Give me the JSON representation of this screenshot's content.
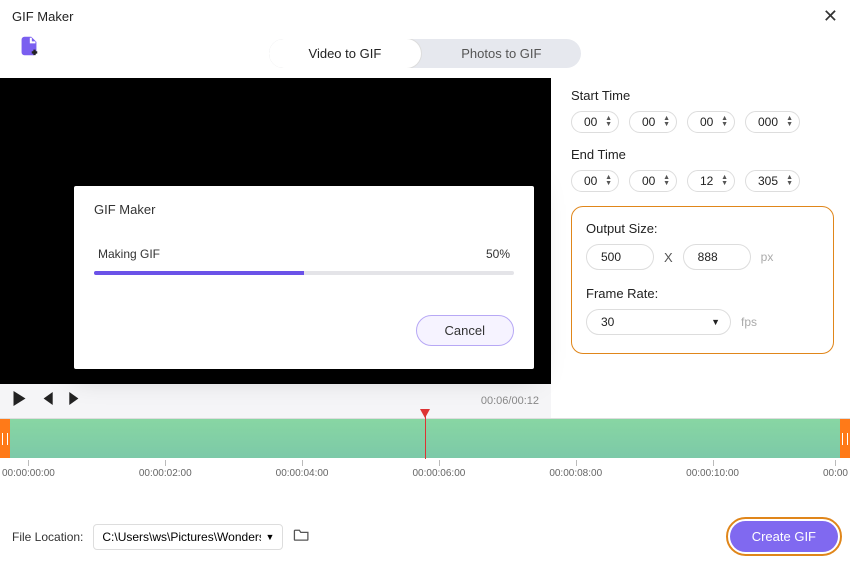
{
  "window": {
    "title": "GIF Maker"
  },
  "tabs": {
    "video": "Video to GIF",
    "photos": "Photos to GIF"
  },
  "modal": {
    "title": "GIF Maker",
    "status": "Making GIF",
    "percent": "50%",
    "cancel": "Cancel"
  },
  "player": {
    "time": "00:06/00:12"
  },
  "settings": {
    "start_label": "Start Time",
    "start": {
      "h": "00",
      "m": "00",
      "s": "00",
      "ms": "000"
    },
    "end_label": "End Time",
    "end": {
      "h": "00",
      "m": "00",
      "s": "12",
      "ms": "305"
    },
    "output_size_label": "Output Size:",
    "output": {
      "w": "500",
      "h": "888",
      "x": "X",
      "unit": "px"
    },
    "frame_rate_label": "Frame Rate:",
    "frame_rate": "30",
    "fps_unit": "fps"
  },
  "ruler": {
    "t0": "00:00:00:00",
    "t1": "00:00:02:00",
    "t2": "00:00:04:00",
    "t3": "00:00:06:00",
    "t4": "00:00:08:00",
    "t5": "00:00:10:00",
    "t6": "00:00"
  },
  "footer": {
    "label": "File Location:",
    "path": "C:\\Users\\ws\\Pictures\\Wonders",
    "create": "Create GIF"
  }
}
